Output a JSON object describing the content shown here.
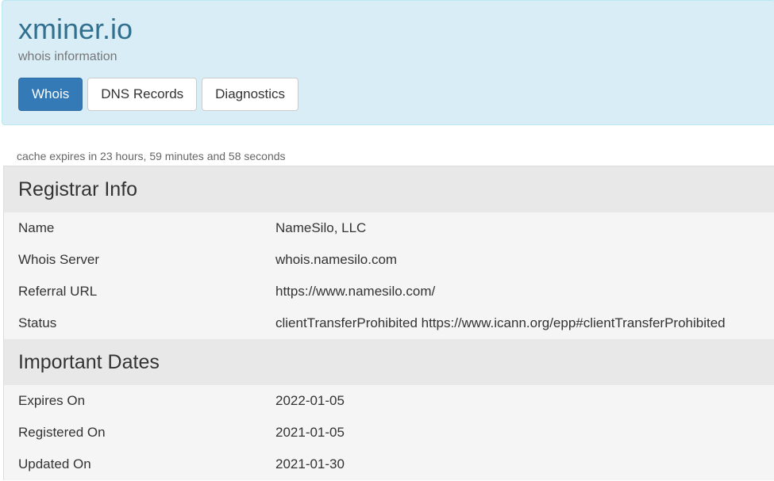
{
  "header": {
    "title": "xminer.io",
    "subtitle": "whois information",
    "tabs": [
      {
        "label": "Whois",
        "active": true
      },
      {
        "label": "DNS Records",
        "active": false
      },
      {
        "label": "Diagnostics",
        "active": false
      }
    ]
  },
  "cache_note": "cache expires in 23 hours, 59 minutes and 58 seconds",
  "sections": [
    {
      "title": "Registrar Info",
      "rows": [
        {
          "key": "Name",
          "value": "NameSilo, LLC"
        },
        {
          "key": "Whois Server",
          "value": "whois.namesilo.com"
        },
        {
          "key": "Referral URL",
          "value": "https://www.namesilo.com/"
        },
        {
          "key": "Status",
          "value": "clientTransferProhibited https://www.icann.org/epp#clientTransferProhibited"
        }
      ]
    },
    {
      "title": "Important Dates",
      "rows": [
        {
          "key": "Expires On",
          "value": "2022-01-05"
        },
        {
          "key": "Registered On",
          "value": "2021-01-05"
        },
        {
          "key": "Updated On",
          "value": "2021-01-30"
        }
      ]
    }
  ],
  "colors": {
    "header_bg": "#d9edf7",
    "title": "#31708f",
    "active_tab": "#337ab7",
    "section_bg": "#e8e8e8",
    "row_bg": "#f5f5f5"
  }
}
